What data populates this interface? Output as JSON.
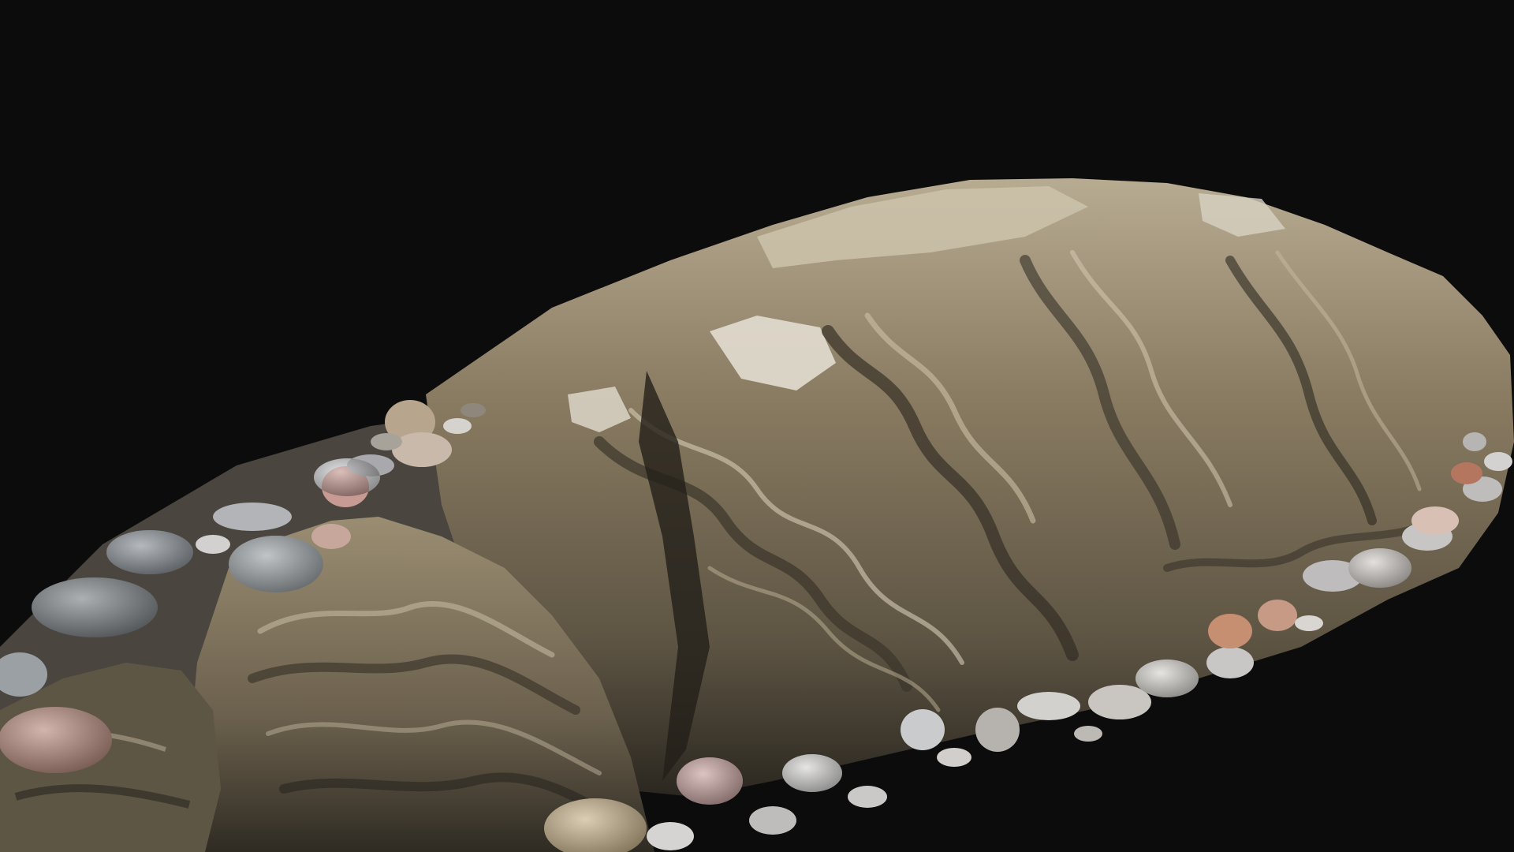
{
  "scene": {
    "subject": "photogrammetry-rock-outcrop",
    "colors": {
      "background": "#0c0c0c",
      "rock_light": "#cfc4ad",
      "rock_mid": "#8f8166",
      "rock_dark": "#3f3a30",
      "rock_shadow": "#26231d",
      "lichen": "#e2ddd0",
      "pebble_grey": "#b9bcbf",
      "pebble_pink": "#c9a39b",
      "pebble_tan": "#c7b48a"
    }
  }
}
